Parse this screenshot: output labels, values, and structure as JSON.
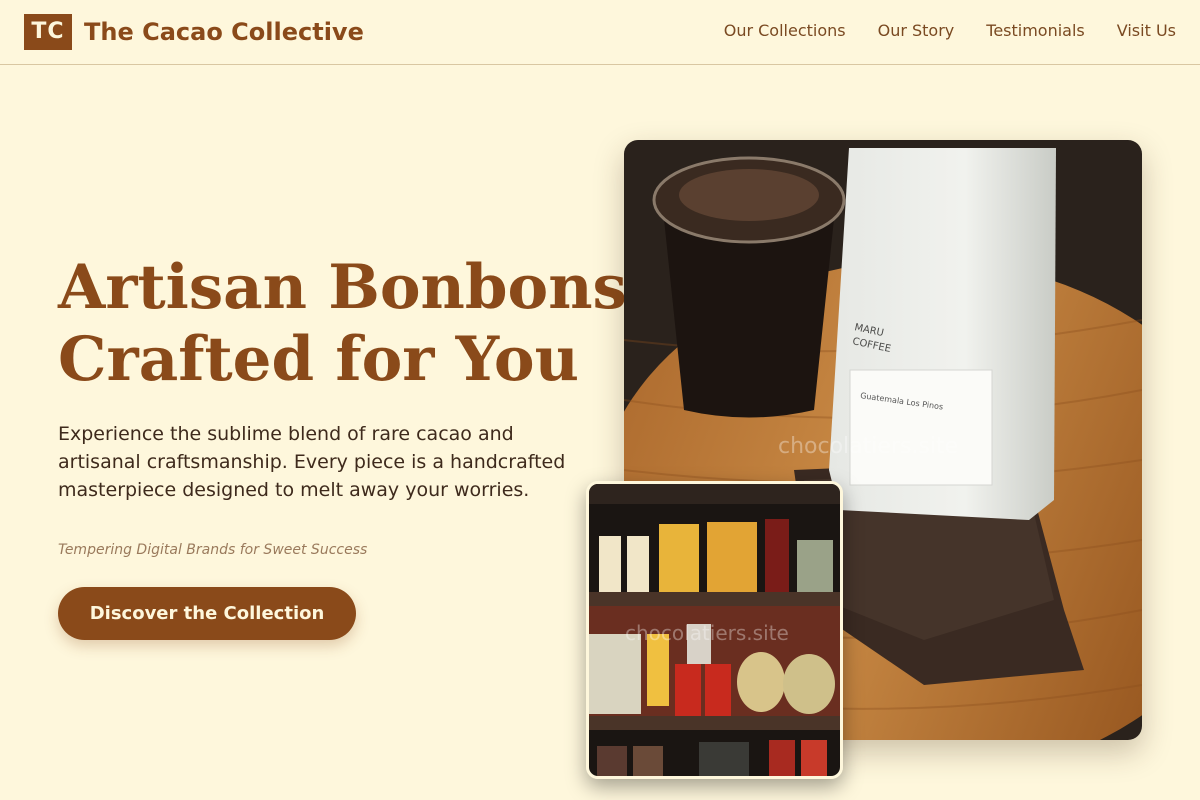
{
  "header": {
    "logo_initials": "TC",
    "brand_name": "The Cacao Collective",
    "nav": [
      "Our Collections",
      "Our Story",
      "Testimonials",
      "Visit Us"
    ]
  },
  "hero": {
    "title_line1": "Artisan Bonbons",
    "title_line2": "Crafted for You",
    "description": "Experience the sublime blend of rare cacao and artisanal craftsmanship. Every piece is a handcrafted masterpiece designed to melt away your worries.",
    "tagline": "Tempering Digital Brands for Sweet Success",
    "cta_label": "Discover the Collection"
  },
  "images": {
    "main_watermark": "chocolatiers.site",
    "main_bag_brand_line1": "MARU",
    "main_bag_brand_line2": "COFFEE",
    "main_bag_label": "Guatemala Los Pinos",
    "secondary_watermark": "chocolatiers.site"
  },
  "colors": {
    "background": "#fef7dc",
    "brand_brown": "#8a4a1a",
    "body_text": "#3e2a1c"
  }
}
